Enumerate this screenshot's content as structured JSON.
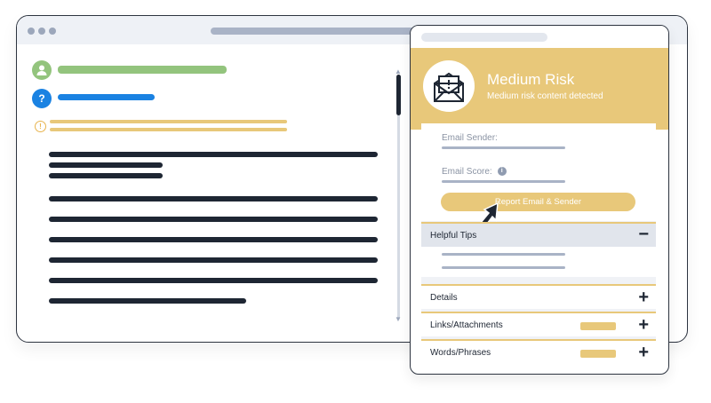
{
  "panel": {
    "risk_title": "Medium Risk",
    "risk_subtitle": "Medium risk content detected",
    "email_sender_label": "Email Sender:",
    "email_score_label": "Email Score:",
    "report_button_label": "Report Email & Sender",
    "helpful_tips_label": "Helpful Tips",
    "details_label": "Details",
    "links_label": "Links/Attachments",
    "words_label": "Words/Phrases",
    "collapse_symbol": "−",
    "expand_symbol": "+",
    "help_symbol": "?",
    "info_symbol": "i",
    "warning_symbol": "!"
  },
  "colors": {
    "risk_accent": "#e8c87a",
    "safe_green": "#93c47d",
    "help_blue": "#1a82e2",
    "dark_text": "#1e2633"
  },
  "icons": [
    "user-icon",
    "help-icon",
    "warning-icon",
    "envelope-alert-icon",
    "info-icon",
    "cursor-arrow-icon",
    "minus-icon",
    "plus-icon"
  ]
}
